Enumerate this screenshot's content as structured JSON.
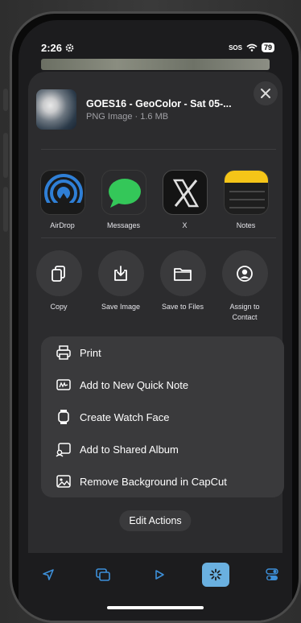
{
  "status": {
    "time": "2:26",
    "sos": "SOS",
    "battery": "79"
  },
  "preview": {
    "title": "GOES16 - GeoColor - Sat 05-...",
    "subtitle": "PNG Image · 1.6 MB"
  },
  "apps": [
    {
      "label": "AirDrop"
    },
    {
      "label": "Messages"
    },
    {
      "label": "X"
    },
    {
      "label": "Notes"
    }
  ],
  "actions": [
    {
      "label": "Copy"
    },
    {
      "label": "Save Image"
    },
    {
      "label": "Save to Files"
    },
    {
      "label": "Assign to Contact"
    }
  ],
  "list": [
    {
      "label": "Print",
      "icon": "printer-icon"
    },
    {
      "label": "Add to New Quick Note",
      "icon": "quick-note-icon"
    },
    {
      "label": "Create Watch Face",
      "icon": "watch-icon"
    },
    {
      "label": "Add to Shared Album",
      "icon": "shared-album-icon"
    },
    {
      "label": "Remove Background in CapCut",
      "icon": "photo-icon"
    }
  ],
  "edit_actions": "Edit Actions",
  "colors": {
    "sheet": "#2c2c2e",
    "accent": "#3d8fd8",
    "active_tab": "#6ab0e0"
  }
}
